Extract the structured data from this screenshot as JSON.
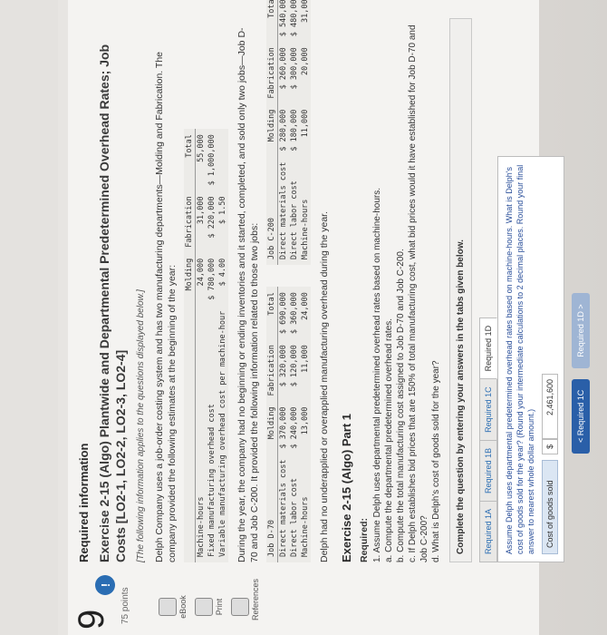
{
  "sidebar": {
    "question_number": "9",
    "badge": "!",
    "points": "75 points",
    "tools": [
      {
        "label": "eBook"
      },
      {
        "label": "Print"
      },
      {
        "label": "References"
      }
    ]
  },
  "header": {
    "required_information": "Required information",
    "exercise_title": "Exercise 2-15 (Algo) Plantwide and Departmental Predetermined Overhead Rates; Job Costs [LO2-1, LO2-2, LO2-3, LO2-4]",
    "note": "[The following information applies to the questions displayed below.]",
    "intro": "Delph Company uses a job-order costing system and has two manufacturing departments—Molding and Fabrication. The company provided the following estimates at the beginning of the year:"
  },
  "estimates_table": {
    "headers": [
      "",
      "Molding",
      "Fabrication",
      "Total"
    ],
    "rows": [
      [
        "Machine-hours",
        "24,000",
        "31,000",
        "55,000"
      ],
      [
        "Fixed manufacturing overhead cost",
        "$ 780,000",
        "$ 220,000",
        "$ 1,000,000"
      ],
      [
        "Variable manufacturing overhead cost per machine-hour",
        "$ 4.00",
        "$ 1.50",
        ""
      ]
    ]
  },
  "paragraph2": "During the year, the company had no beginning or ending inventories and it started, completed, and sold only two jobs—Job D-70 and Job C-200. It provided the following information related to those two jobs:",
  "job_d70": {
    "headers": [
      "Job D-70",
      "Molding",
      "Fabrication",
      "Total"
    ],
    "rows": [
      [
        "Direct materials cost",
        "$ 370,000",
        "$ 320,000",
        "$ 690,000"
      ],
      [
        "Direct labor cost",
        "$ 240,000",
        "$ 120,000",
        "$ 360,000"
      ],
      [
        "Machine-hours",
        "13,000",
        "11,000",
        "24,000"
      ]
    ]
  },
  "job_c200": {
    "headers": [
      "Job C-200",
      "Molding",
      "Fabrication",
      "Total"
    ],
    "rows": [
      [
        "Direct materials cost",
        "$ 280,000",
        "$ 260,000",
        "$ 540,000"
      ],
      [
        "Direct labor cost",
        "$ 180,000",
        "$ 300,000",
        "$ 480,000"
      ],
      [
        "Machine-hours",
        "11,000",
        "20,000",
        "31,000"
      ]
    ]
  },
  "paragraph3": "Delph had no underapplied or overapplied manufacturing overhead during the year.",
  "part": {
    "title": "Exercise 2-15 (Algo) Part 1",
    "required_label": "Required:",
    "items": [
      "1. Assume Delph uses departmental predetermined overhead rates based on machine-hours.",
      "a. Compute the departmental predetermined overhead rates.",
      "b. Compute the total manufacturing cost assigned to Job D-70 and Job C-200.",
      "c. If Delph establishes bid prices that are 150% of total manufacturing cost, what bid prices would it have established for Job D-70 and Job C-200?",
      "d. What is Delph's cost of goods sold for the year?"
    ]
  },
  "complete_box": "Complete the question by entering your answers in the tabs given below.",
  "tabs": [
    {
      "label": "Required 1A"
    },
    {
      "label": "Required 1B"
    },
    {
      "label": "Required 1C"
    },
    {
      "label": "Required 1D"
    }
  ],
  "active_tab_text": "Assume Delph uses departmental predetermined overhead rates based on machine-hours. What is Delph's cost of goods sold for the year? (Round your intermediate calculations to 2 decimal places. Round your final answer to nearest whole dollar amount.)",
  "answer": {
    "label": "Cost of goods sold",
    "currency": "$",
    "value": "2,461,600"
  },
  "nav": {
    "prev": "< Required 1C",
    "next": "Required 1D >"
  }
}
